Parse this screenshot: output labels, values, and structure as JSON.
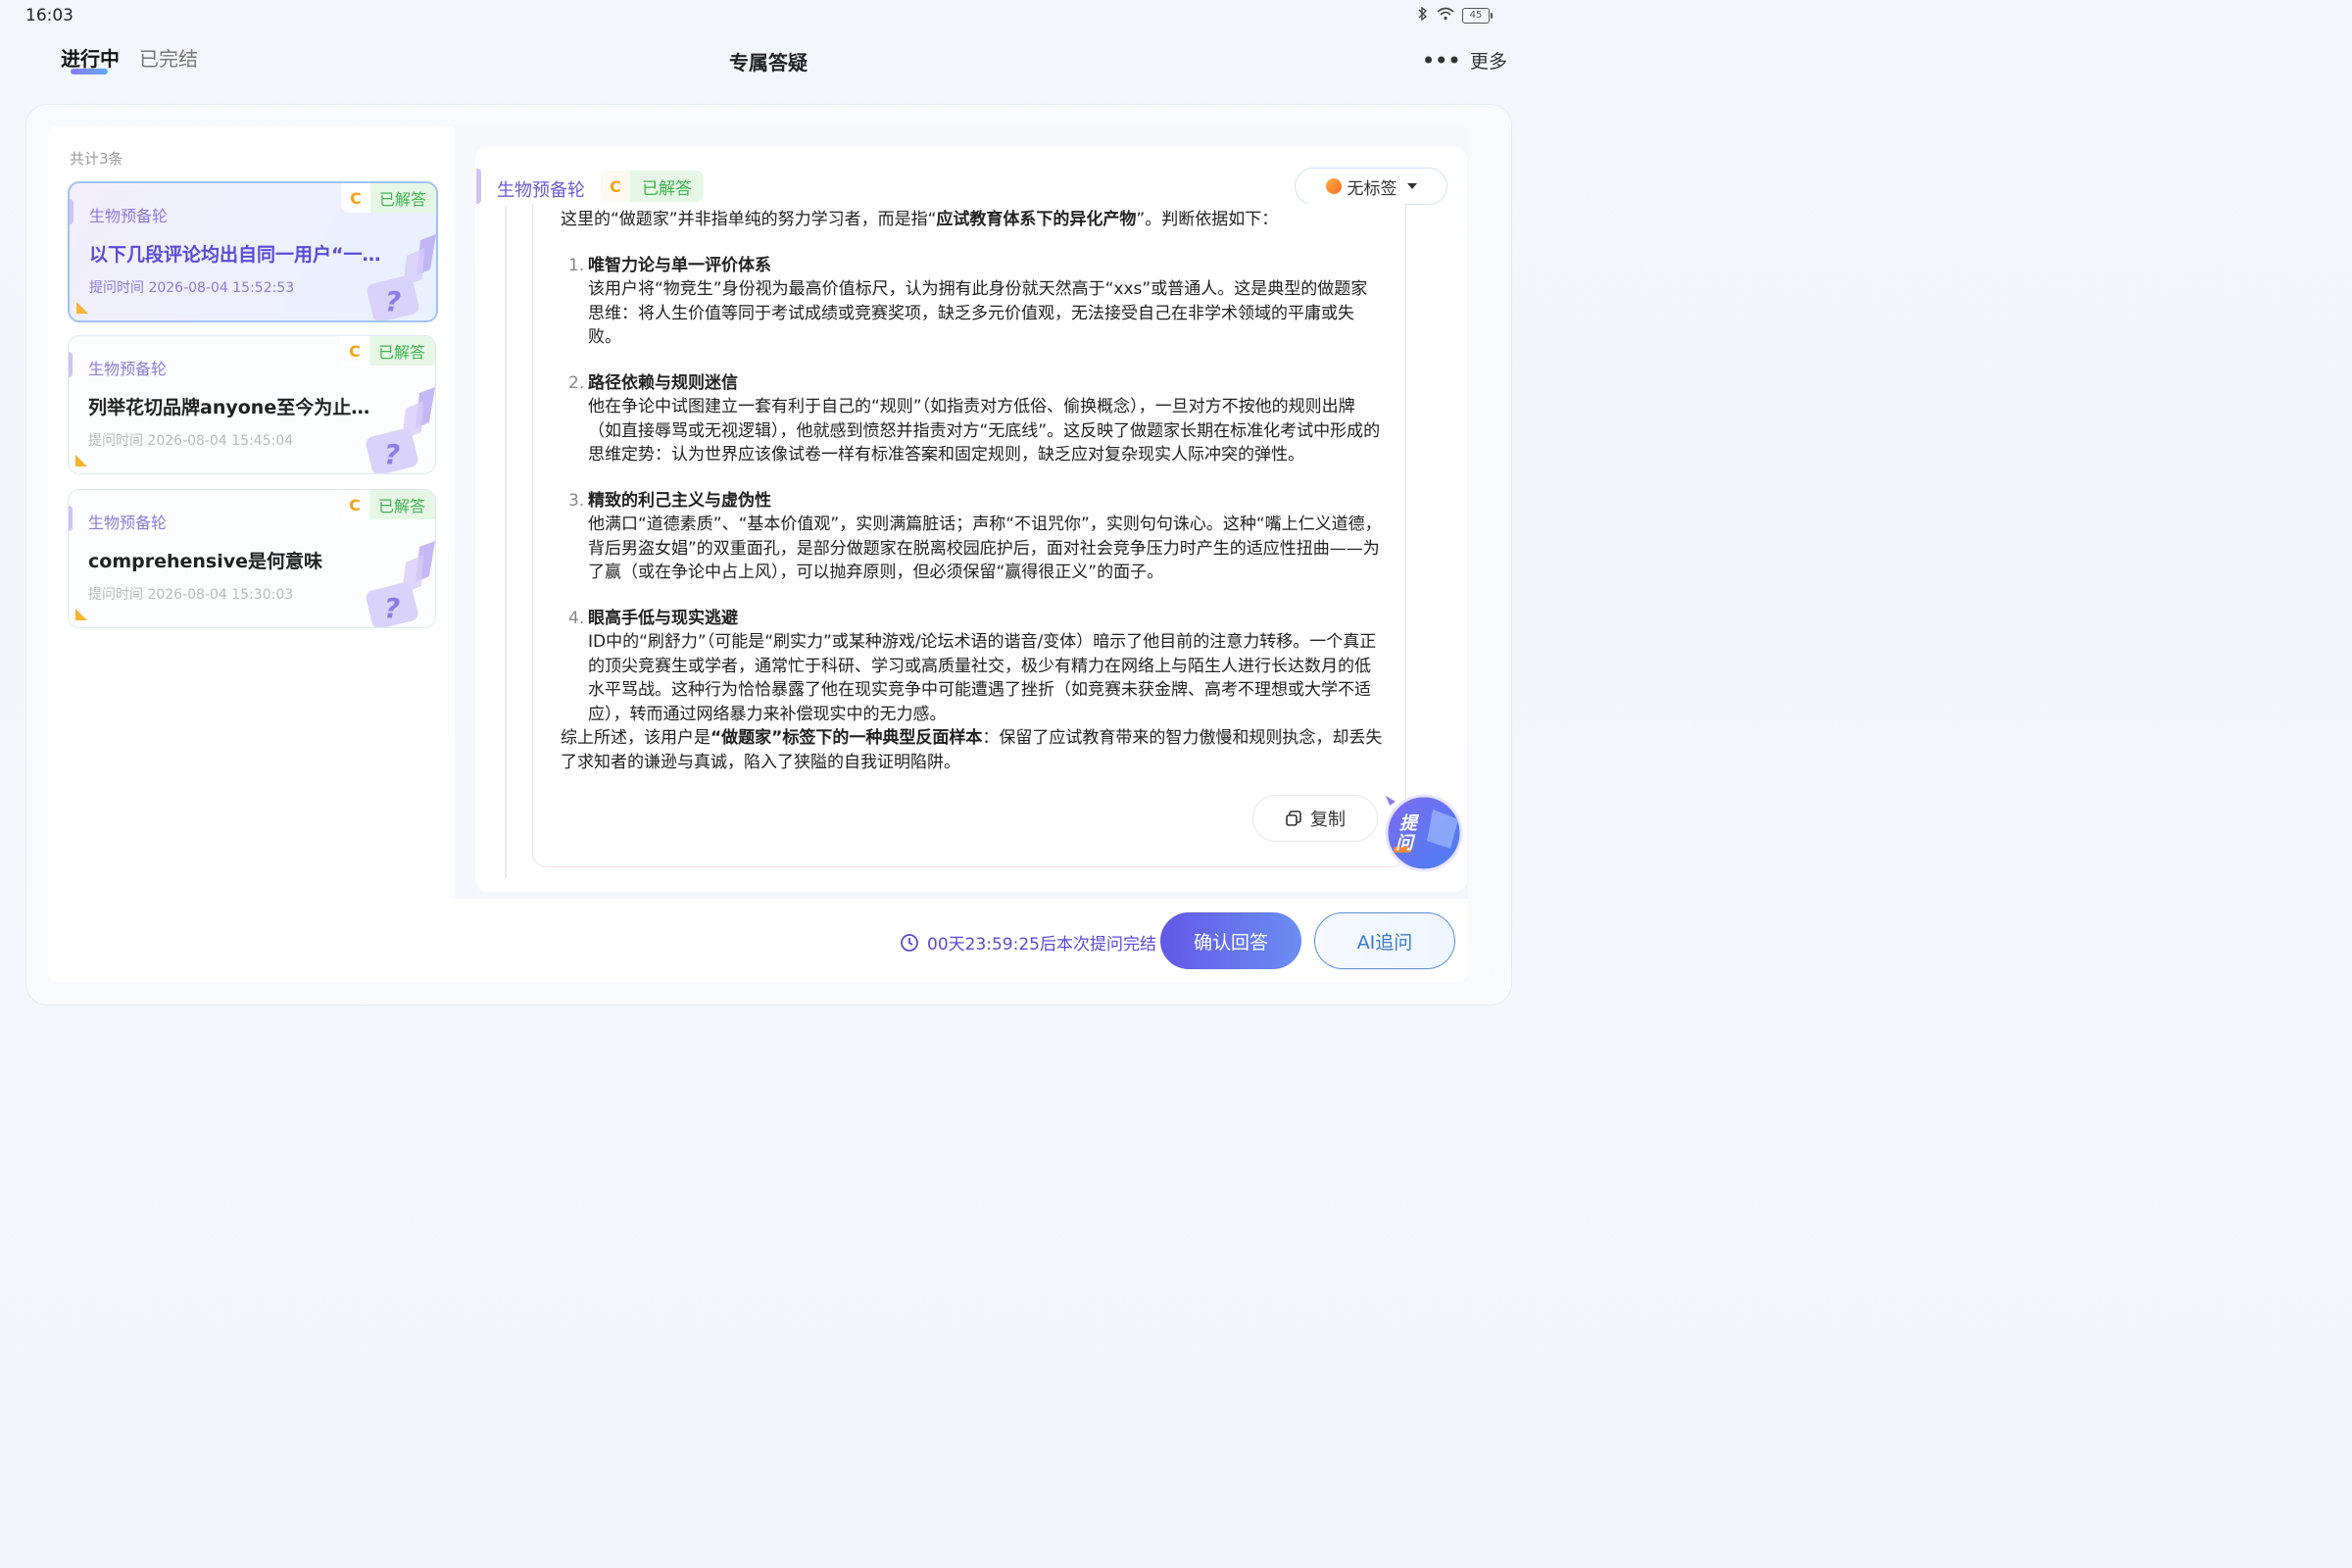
{
  "status": {
    "time": "16:03",
    "battery": "45"
  },
  "header": {
    "tabs": [
      {
        "label": "进行中"
      },
      {
        "label": "已完结"
      }
    ],
    "title": "专属答疑",
    "more_label": "更多"
  },
  "list": {
    "count_label": "共计3条",
    "cards": [
      {
        "subject": "生物预备轮",
        "title": "以下几段评论均出自同一用户“一位…",
        "time": "提问时间 2026-08-04 15:52:53",
        "badge_letter": "C",
        "status": "已解答"
      },
      {
        "subject": "生物预备轮",
        "title": "列举花切品牌anyone至今为止发售…",
        "time": "提问时间 2026-08-04 15:45:04",
        "badge_letter": "C",
        "status": "已解答"
      },
      {
        "subject": "生物预备轮",
        "title": "comprehensive是何意味",
        "time": "提问时间 2026-08-04 15:30:03",
        "badge_letter": "C",
        "status": "已解答"
      }
    ]
  },
  "detail": {
    "subject": "生物预备轮",
    "badge_letter": "C",
    "status": "已解答",
    "tag_label": "无标签",
    "intro_pre": "这里的“做题家”并非指单纯的努力学习者，而是指“",
    "intro_bold": "应试教育体系下的异化产物",
    "intro_post": "”。判断依据如下：",
    "points": [
      {
        "num": "1.",
        "title": "唯智力论与单一评价体系",
        "body": "该用户将“物竞生”身份视为最高价值标尺，认为拥有此身份就天然高于“xxs”或普通人。这是典型的做题家思维：将人生价值等同于考试成绩或竞赛奖项，缺乏多元价值观，无法接受自己在非学术领域的平庸或失败。"
      },
      {
        "num": "2.",
        "title": "路径依赖与规则迷信",
        "body": "他在争论中试图建立一套有利于自己的“规则”（如指责对方低俗、偷换概念），一旦对方不按他的规则出牌（如直接辱骂或无视逻辑），他就感到愤怒并指责对方“无底线”。这反映了做题家长期在标准化考试中形成的思维定势：认为世界应该像试卷一样有标准答案和固定规则，缺乏应对复杂现实人际冲突的弹性。"
      },
      {
        "num": "3.",
        "title": "精致的利己主义与虚伪性",
        "body": "他满口“道德素质”、“基本价值观”，实则满篇脏话；声称“不诅咒你”，实则句句诛心。这种“嘴上仁义道德，背后男盗女娼”的双重面孔，是部分做题家在脱离校园庇护后，面对社会竞争压力时产生的适应性扭曲——为了赢（或在争论中占上风），可以抛弃原则，但必须保留“赢得很正义”的面子。"
      },
      {
        "num": "4.",
        "title": "眼高手低与现实逃避",
        "body": "ID中的“刷舒力”（可能是“刷实力”或某种游戏/论坛术语的谐音/变体）暗示了他目前的注意力转移。一个真正的顶尖竞赛生或学者，通常忙于科研、学习或高质量社交，极少有精力在网络上与陌生人进行长达数月的低水平骂战。这种行为恰恰暴露了他在现实竞争中可能遭遇了挫折（如竞赛未获金牌、高考不理想或大学不适应），转而通过网络暴力来补偿现实中的无力感。"
      }
    ],
    "summary_pre": "综上所述，该用户是",
    "summary_bold": "“做题家”标签下的一种典型反面样本",
    "summary_post": "：保留了应试教育带来的智力傲慢和规则执念，却丢失了求知者的谦逊与真诚，陷入了狭隘的自我证明陷阱。",
    "copy_label": "复制",
    "float_label_1": "提",
    "float_label_2": "问"
  },
  "footer": {
    "countdown": "00天23:59:25后本次提问完结",
    "confirm_label": "确认回答",
    "ai_label": "AI追问"
  },
  "colors": {
    "accent": "#5a4bd8",
    "success": "#3fb34f",
    "badge_c": "#f4a417"
  }
}
